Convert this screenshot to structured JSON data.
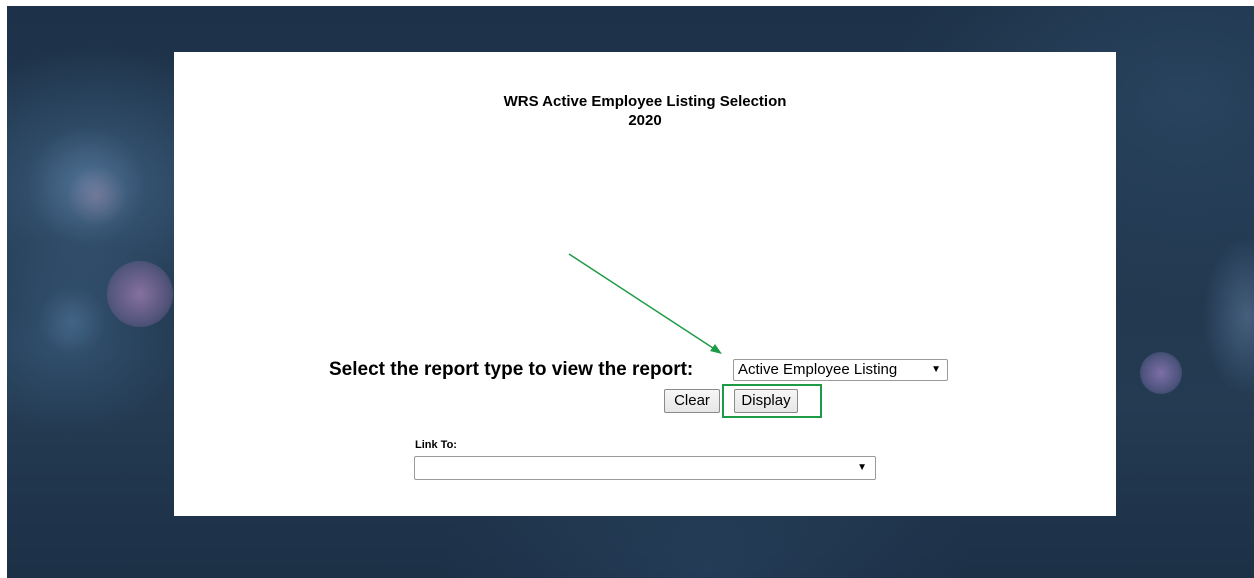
{
  "page": {
    "title_line1": "WRS Active Employee Listing Selection",
    "title_line2": "2020"
  },
  "report": {
    "label": "Select the report type to view the report:",
    "selected_value": "Active Employee Listing",
    "caret": "▼"
  },
  "buttons": {
    "clear_label": "Clear",
    "display_label": "Display"
  },
  "link_to": {
    "label": "Link To:",
    "selected_value": "",
    "caret": "▼"
  },
  "annotations": {
    "arrow_color": "#1e9b46",
    "highlight_color": "#1e9b46"
  },
  "colors": {
    "background": "#21374e",
    "panel": "#ffffff"
  }
}
